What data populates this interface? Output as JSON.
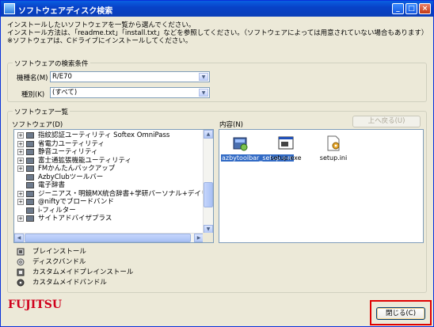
{
  "window": {
    "title": "ソフトウェアディスク検索"
  },
  "titlebar_buttons": [
    "_",
    "□",
    "×"
  ],
  "intro": {
    "line1": "インストールしたいソフトウェアを一覧から選んでください。",
    "line2": "インストール方法は、「readme.txt」「install.txt」などを参照してください。（ソフトウェアによっては用意されていない場合もあります）",
    "line3": "※ソフトウェアは、Cドライブにインストールしてください。"
  },
  "search": {
    "legend": "ソフトウェアの検索条件",
    "model_label": "機種名(M)",
    "model_value": "R/E70",
    "type_label": "種別(K)",
    "type_value": "(すべて)"
  },
  "list": {
    "legend": "ソフトウェア一覧",
    "software_label": "ソフトウェア(D)",
    "content_label": "内容(N)",
    "up_button": "上へ戻る(U)",
    "tree_items": [
      {
        "label": "指紋認証ユーティリティ Softex OmniPass",
        "expander": "+"
      },
      {
        "label": "省電力ユーティリティ",
        "expander": "+"
      },
      {
        "label": "静音ユーティリティ",
        "expander": "+"
      },
      {
        "label": "富士通拡張機能ユーティリティ",
        "expander": "+"
      },
      {
        "label": "FMかんたんバックアップ",
        "expander": "+"
      },
      {
        "label": "AzbyClubツールバー",
        "expander": ""
      },
      {
        "label": "電子辞書",
        "expander": ""
      },
      {
        "label": "ジーニアス・明鏡MX統合辞書+学研パーソナル+デイリー",
        "expander": "+"
      },
      {
        "label": "@niftyでブロードバンド",
        "expander": "+"
      },
      {
        "label": "i-フィルター",
        "expander": ""
      },
      {
        "label": "サイトアドバイザプラス",
        "expander": "+"
      }
    ],
    "files": [
      {
        "name": "azbytoolbar_setup.exe",
        "icon": "installer-icon"
      },
      {
        "name": "setup.exe",
        "icon": "exe-icon"
      },
      {
        "name": "setup.ini",
        "icon": "ini-file-icon"
      }
    ]
  },
  "legend_items": [
    {
      "label": "ブレインストール",
      "icon": "preinstall-icon"
    },
    {
      "label": "ディスクバンドル",
      "icon": "disc-bundle-icon"
    },
    {
      "label": "カスタムメイドプレインストール",
      "icon": "custom-preinstall-icon"
    },
    {
      "label": "カスタムメイドバンドル",
      "icon": "custom-bundle-icon"
    }
  ],
  "brand": {
    "logo_text": "FUJITSU"
  },
  "close_button": "閉じる(C)",
  "colors": {
    "titlebar": "#0842c8",
    "selection": "#316ac5",
    "logo": "#d0001c",
    "highlight_frame": "#e00000"
  }
}
